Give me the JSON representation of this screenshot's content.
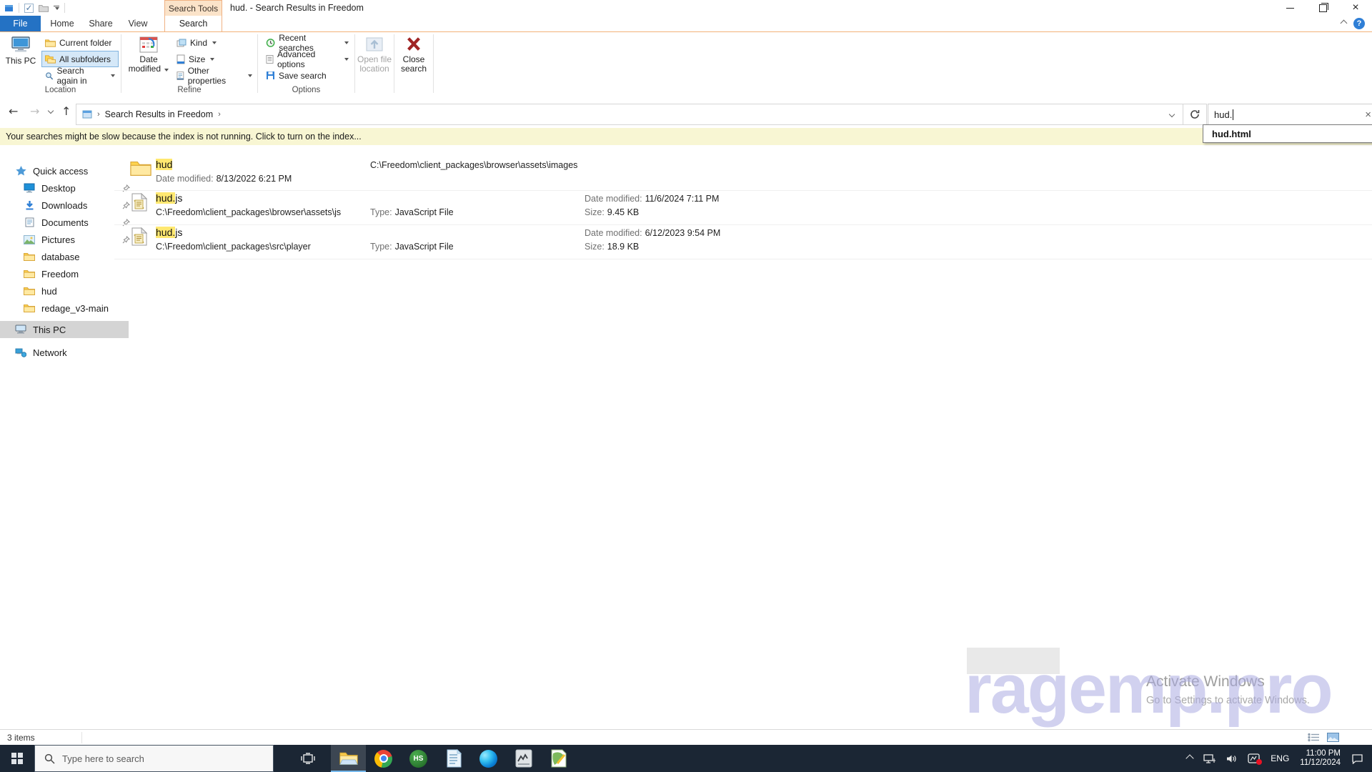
{
  "titlebar": {
    "contextual_tab": "Search Tools",
    "title": "hud. - Search Results in Freedom"
  },
  "tabs": {
    "file": "File",
    "home": "Home",
    "share": "Share",
    "view": "View",
    "search": "Search"
  },
  "ribbon": {
    "this_pc": "This PC",
    "current_folder": "Current folder",
    "all_subfolders": "All subfolders",
    "search_again": "Search again in",
    "date_modified": "Date modified",
    "kind": "Kind",
    "size": "Size",
    "other_properties": "Other properties",
    "recent_searches": "Recent searches",
    "advanced_options": "Advanced options",
    "save_search": "Save search",
    "open_file_location": "Open file location",
    "close_search": "Close search",
    "groups": {
      "location": "Location",
      "refine": "Refine",
      "options": "Options"
    }
  },
  "address": {
    "breadcrumb_item": "Search Results in Freedom",
    "search_value": "hud.",
    "search_suggestion": "hud.html"
  },
  "notification": {
    "text": "Your searches might be slow because the index is not running.  Click to turn on the index..."
  },
  "sidebar": {
    "items": [
      {
        "label": "Quick access"
      },
      {
        "label": "Desktop"
      },
      {
        "label": "Downloads"
      },
      {
        "label": "Documents"
      },
      {
        "label": "Pictures"
      },
      {
        "label": "database"
      },
      {
        "label": "Freedom"
      },
      {
        "label": "hud"
      },
      {
        "label": "redage_v3-main"
      },
      {
        "label": "This PC"
      },
      {
        "label": "Network"
      }
    ]
  },
  "results": {
    "rows": [
      {
        "name_hl": "hud",
        "name_rest": "",
        "meta1_label": "Date modified:",
        "meta1_value": "8/13/2022 6:21 PM",
        "center_value": "C:\\Freedom\\client_packages\\browser\\assets\\images"
      },
      {
        "name_hl": "hud.",
        "name_rest": "js",
        "path": "C:\\Freedom\\client_packages\\browser\\assets\\js",
        "type_label": "Type:",
        "type_value": "JavaScript File",
        "date_label": "Date modified:",
        "date_value": "11/6/2024 7:11 PM",
        "size_label": "Size:",
        "size_value": "9.45 KB"
      },
      {
        "name_hl": "hud.",
        "name_rest": "js",
        "path": "C:\\Freedom\\client_packages\\src\\player",
        "type_label": "Type:",
        "type_value": "JavaScript File",
        "date_label": "Date modified:",
        "date_value": "6/12/2023 9:54 PM",
        "size_label": "Size:",
        "size_value": "18.9 KB"
      }
    ]
  },
  "status": {
    "count": "3 items"
  },
  "watermark": {
    "brand": "ragemp.pro",
    "line1": "Activate Windows",
    "line2": "Go to Settings to activate Windows."
  },
  "taskbar": {
    "search_placeholder": "Type here to search",
    "hs_label": "HS",
    "lang": "ENG",
    "time": "11:00 PM",
    "date": "11/12/2024"
  },
  "colors": {
    "accent_blue": "#2472c4",
    "contextual_peach": "#fbe3c9",
    "contextual_border": "#f0b183",
    "highlight_yellow": "#ffe870",
    "notification_bg": "#f8f6d3",
    "taskbar_bg": "#1b2634",
    "selected_gray": "#d4d4d4",
    "watermark_purple": "#ababe2"
  }
}
